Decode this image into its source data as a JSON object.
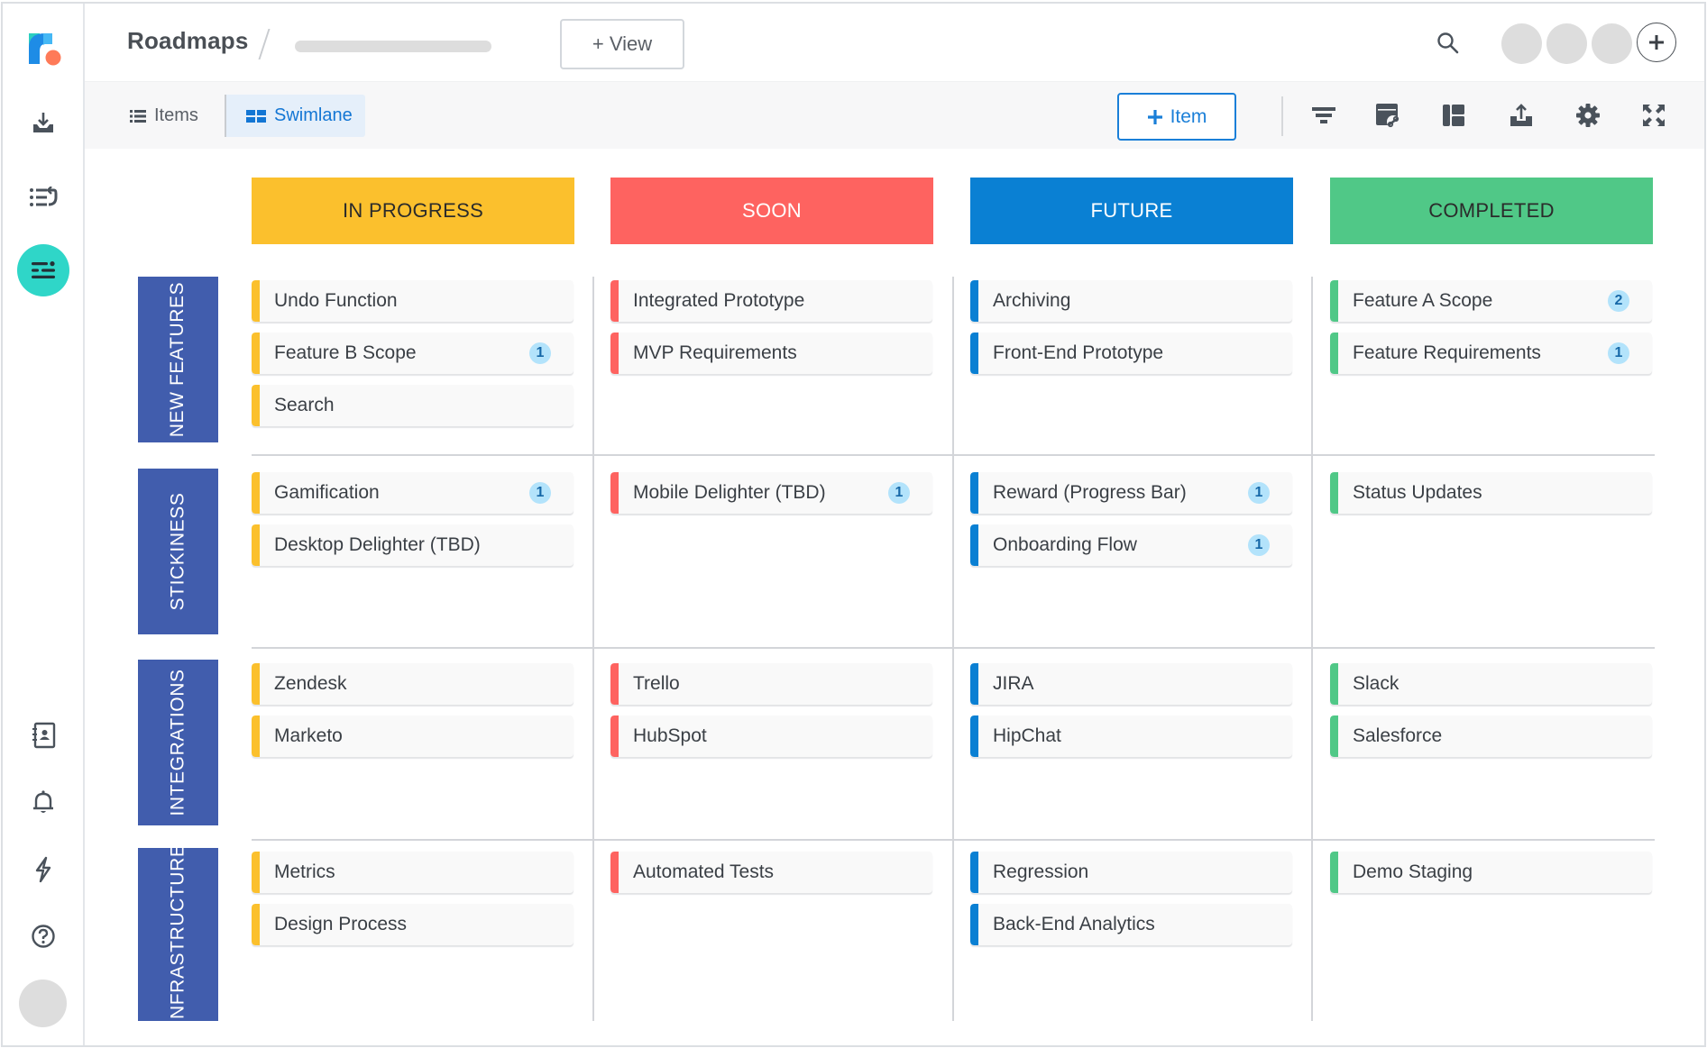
{
  "app": {
    "title": "Roadmaps",
    "add_view_label": "+ View",
    "colors": {
      "accent": "#1a7fd8",
      "sidebar_active": "#2fd6c8",
      "row_label": "#415dad",
      "badge_bg": "#b3e3fb",
      "badge_text": "#1668a8"
    }
  },
  "sidebar": {
    "items": [
      {
        "name": "logo",
        "icon": "roadmunk-logo"
      },
      {
        "name": "inbox",
        "icon": "inbox-download-icon"
      },
      {
        "name": "backlog",
        "icon": "list-redo-icon"
      },
      {
        "name": "roadmaps",
        "icon": "roadmap-lines-icon",
        "active": true
      },
      {
        "name": "contacts",
        "icon": "address-book-icon"
      },
      {
        "name": "notifications",
        "icon": "bell-icon"
      },
      {
        "name": "integrations",
        "icon": "bolt-icon"
      },
      {
        "name": "help",
        "icon": "help-circle-icon"
      },
      {
        "name": "profile",
        "icon": "avatar"
      }
    ]
  },
  "header": {
    "search_icon": "search-icon",
    "avatars": 3,
    "add_member_icon": "plus-icon"
  },
  "toolbar": {
    "tabs": [
      {
        "label": "Items",
        "icon": "list-icon",
        "active": false
      },
      {
        "label": "Swimlane",
        "icon": "grid-icon",
        "active": true
      }
    ],
    "add_item_label": "Item",
    "icons": [
      "filter-icon",
      "linked-calendar-icon",
      "layout-icon",
      "export-icon",
      "settings-icon",
      "fullscreen-icon"
    ]
  },
  "columns": [
    {
      "label": "IN PROGRESS",
      "color": "#fbc02d",
      "text_color": "#2b2b2b"
    },
    {
      "label": "SOON",
      "color": "#fe6360",
      "text_color": "#ffffff"
    },
    {
      "label": "FUTURE",
      "color": "#0a80d3",
      "text_color": "#ffffff"
    },
    {
      "label": "COMPLETED",
      "color": "#50c887",
      "text_color": "#2b2b2b"
    }
  ],
  "rows": [
    {
      "label": "NEW FEATURES",
      "cells": [
        [
          {
            "title": "Undo Function"
          },
          {
            "title": "Feature B Scope",
            "badge": "1"
          },
          {
            "title": "Search"
          }
        ],
        [
          {
            "title": "Integrated Prototype"
          },
          {
            "title": "MVP Requirements"
          }
        ],
        [
          {
            "title": "Archiving"
          },
          {
            "title": "Front-End Prototype"
          }
        ],
        [
          {
            "title": "Feature A Scope",
            "badge": "2"
          },
          {
            "title": "Feature Requirements",
            "badge": "1"
          }
        ]
      ]
    },
    {
      "label": "STICKINESS",
      "cells": [
        [
          {
            "title": "Gamification",
            "badge": "1"
          },
          {
            "title": "Desktop Delighter (TBD)"
          }
        ],
        [
          {
            "title": "Mobile Delighter (TBD)",
            "badge": "1"
          }
        ],
        [
          {
            "title": "Reward (Progress Bar)",
            "badge": "1"
          },
          {
            "title": "Onboarding Flow",
            "badge": "1"
          }
        ],
        [
          {
            "title": "Status Updates"
          }
        ]
      ]
    },
    {
      "label": "INTEGRATIONS",
      "cells": [
        [
          {
            "title": "Zendesk"
          },
          {
            "title": "Marketo"
          }
        ],
        [
          {
            "title": "Trello"
          },
          {
            "title": "HubSpot"
          }
        ],
        [
          {
            "title": "JIRA"
          },
          {
            "title": "HipChat"
          }
        ],
        [
          {
            "title": "Slack"
          },
          {
            "title": "Salesforce"
          }
        ]
      ]
    },
    {
      "label": "INFRASTRUCTURE",
      "cells": [
        [
          {
            "title": "Metrics"
          },
          {
            "title": "Design Process"
          }
        ],
        [
          {
            "title": "Automated Tests"
          }
        ],
        [
          {
            "title": "Regression"
          },
          {
            "title": "Back-End Analytics"
          }
        ],
        [
          {
            "title": "Demo Staging"
          }
        ]
      ]
    }
  ]
}
